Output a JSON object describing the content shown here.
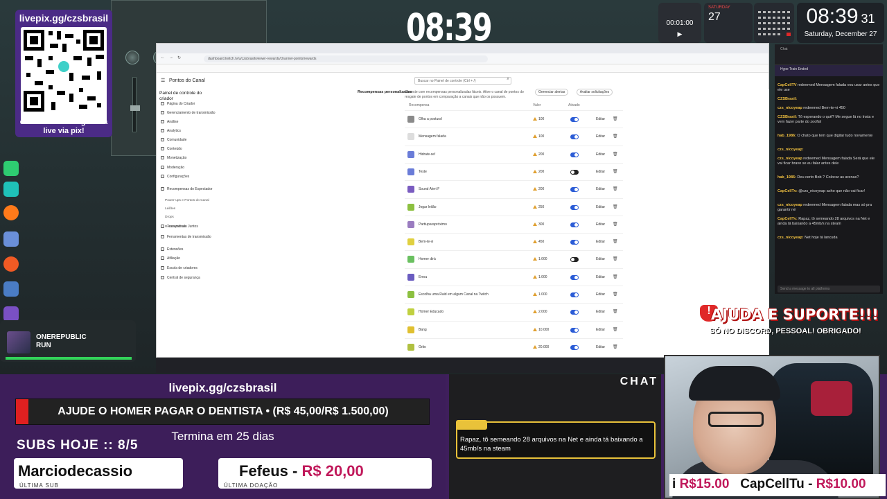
{
  "overlay": {
    "qr_url": "livepix.gg/czsbrasil",
    "qr_message": "envie sua mensagem na live via pix!",
    "big_clock": "08:39",
    "timer": "00:01:00",
    "cal_day": "27",
    "cal_month": "SATURDAY",
    "clock_time": "08:39",
    "clock_seconds": "31",
    "clock_date": "Saturday, December 27",
    "music_artist": "ONEREPUBLIC",
    "music_title": "RUN",
    "music_progress": 1.0,
    "support_title": "AJUDA E SUPORTE!!!",
    "support_sub": "SÓ NO DISCORD, PESSOAL! OBRIGADO!",
    "goal_url": "livepix.gg/czsbrasil",
    "goal_text": "AJUDE O HOMER PAGAR O DENTISTA  •  (R$ 45,00/R$ 1.500,00)",
    "goal_current": 45.0,
    "goal_target": 1500.0,
    "goal_ends": "Termina em 25 dias",
    "subs_today": "SUBS HOJE :: 8/5",
    "last_sub_name": "Marciodecassio",
    "last_sub_label": "ÚLTIMA SUB",
    "last_don_name": "Fefeus - ",
    "last_don_value": "R$ 20,00",
    "last_don_label": "ÚLTIMA DOAÇÃO",
    "chat_header": "CHAT",
    "chat_message": "Rapaz, tô semeando 28 arquivos na Net e ainda tá baixando a 45mb/s na steam",
    "ticker_val1": "R$15.00",
    "ticker_name2": "CapCellTu",
    "ticker_val2": "R$10.00",
    "ticker_prefix": "i"
  },
  "browser": {
    "url": "dashboard.twitch.tv/u/czsbrasil/viewer-rewards/channel-points/rewards",
    "page_title": "Pontos do Canal",
    "search_placeholder": "Buscar no Painel de controle (Ctrl + /)",
    "sidebar_title": "Painel de controle do criador",
    "sidebar_items": [
      "Página do Criador",
      "Gerenciamento de transmissão",
      "Análise",
      "Analytics",
      "Comunidade",
      "Conteúdo",
      "Monetização",
      "Moderação",
      "Configurações",
      "Recompensas do Espectador",
      "Transmitindo Juntos",
      "Ferramentas de transmissão",
      "Extensões",
      "Afiliação",
      "Escola de criadores",
      "Central de segurança"
    ],
    "sidebar_subitems": [
      "Power-ups e Pontos do Canal",
      "Leilões",
      "Drops",
      "Recompensas"
    ],
    "section_title": "Recompensas personalizadas",
    "section_desc": "Conecte com recompensas personalizadas fáceis. Ative o canal de pontos do resgate de pontos em comparação a canais que não os possuem.",
    "action_manage": "Gerenciar alertas",
    "action_review": "Avaliar solicitações",
    "col_reward": "Recompensa",
    "col_cost": "Valor",
    "col_active": "Ativado",
    "edit_label": "Editar",
    "rewards": [
      {
        "name": "Olha a postura!",
        "cost": "100",
        "on": true
      },
      {
        "name": "Mensagem falada",
        "cost": "100",
        "on": true
      },
      {
        "name": "Hidrate-se!",
        "cost": "200",
        "on": true
      },
      {
        "name": "Teste",
        "cost": "200",
        "on": false
      },
      {
        "name": "Sound Alert F",
        "cost": "200",
        "on": true
      },
      {
        "name": "Jogar leilão",
        "cost": "250",
        "on": true
      },
      {
        "name": "Partiuparapróximo",
        "cost": "300",
        "on": true
      },
      {
        "name": "Bem-te-vi",
        "cost": "450",
        "on": true
      },
      {
        "name": "Homer dirá",
        "cost": "1.000",
        "on": false
      },
      {
        "name": "Errou",
        "cost": "1.000",
        "on": true
      },
      {
        "name": "Escolha uma Raid em algum Canal na Twitch",
        "cost": "1.000",
        "on": true
      },
      {
        "name": "Homer Educado",
        "cost": "2.000",
        "on": true
      },
      {
        "name": "Bang",
        "cost": "10.000",
        "on": true
      },
      {
        "name": "Grito",
        "cost": "20.000",
        "on": true
      }
    ]
  },
  "chat": {
    "hype": "Hype Train Ended",
    "input_placeholder": "Send a message to all platforms",
    "messages": [
      {
        "user": "CapCellTV",
        "text": " redeemed Mensagem falada  vou usar antes que ele use"
      },
      {
        "user": "CZSBrasil:",
        "text": ""
      },
      {
        "user": "czs_nicoyeap",
        "text": " redeemed Bem-te-vi 450"
      },
      {
        "user": "CZSBrasil:",
        "text": " Tô esperando o quê? Me segue lá no Insta e vem fazer parte do zoofia!"
      },
      {
        "user": "hab_1986:",
        "text": " O chato que tem que digitar tudo novamente"
      },
      {
        "user": "czs_nicoyeap:",
        "text": ""
      },
      {
        "user": "czs_nicoyeap",
        "text": " redeemed Mensagem falada  Será que ele vai ficar bravo se eu falar antes dele"
      },
      {
        "user": "hab_1986:",
        "text": " Deu certo Bob ? Colocar as arenas?"
      },
      {
        "user": "CapCellTv:",
        "text": " @czs_nicoyeap acho que não vai ficar!"
      },
      {
        "user": "czs_nicoyeap",
        "text": " redeemed Mensagem falada  mas só pra garantir né"
      },
      {
        "user": "CapCellTv:",
        "text": " Rapaz, tô semeando 28 arquivos na Net e ainda tá baixando a 45mb/s na steam"
      },
      {
        "user": "czs_nicoyeap:",
        "text": " Net hoje tá lancuda"
      }
    ]
  }
}
